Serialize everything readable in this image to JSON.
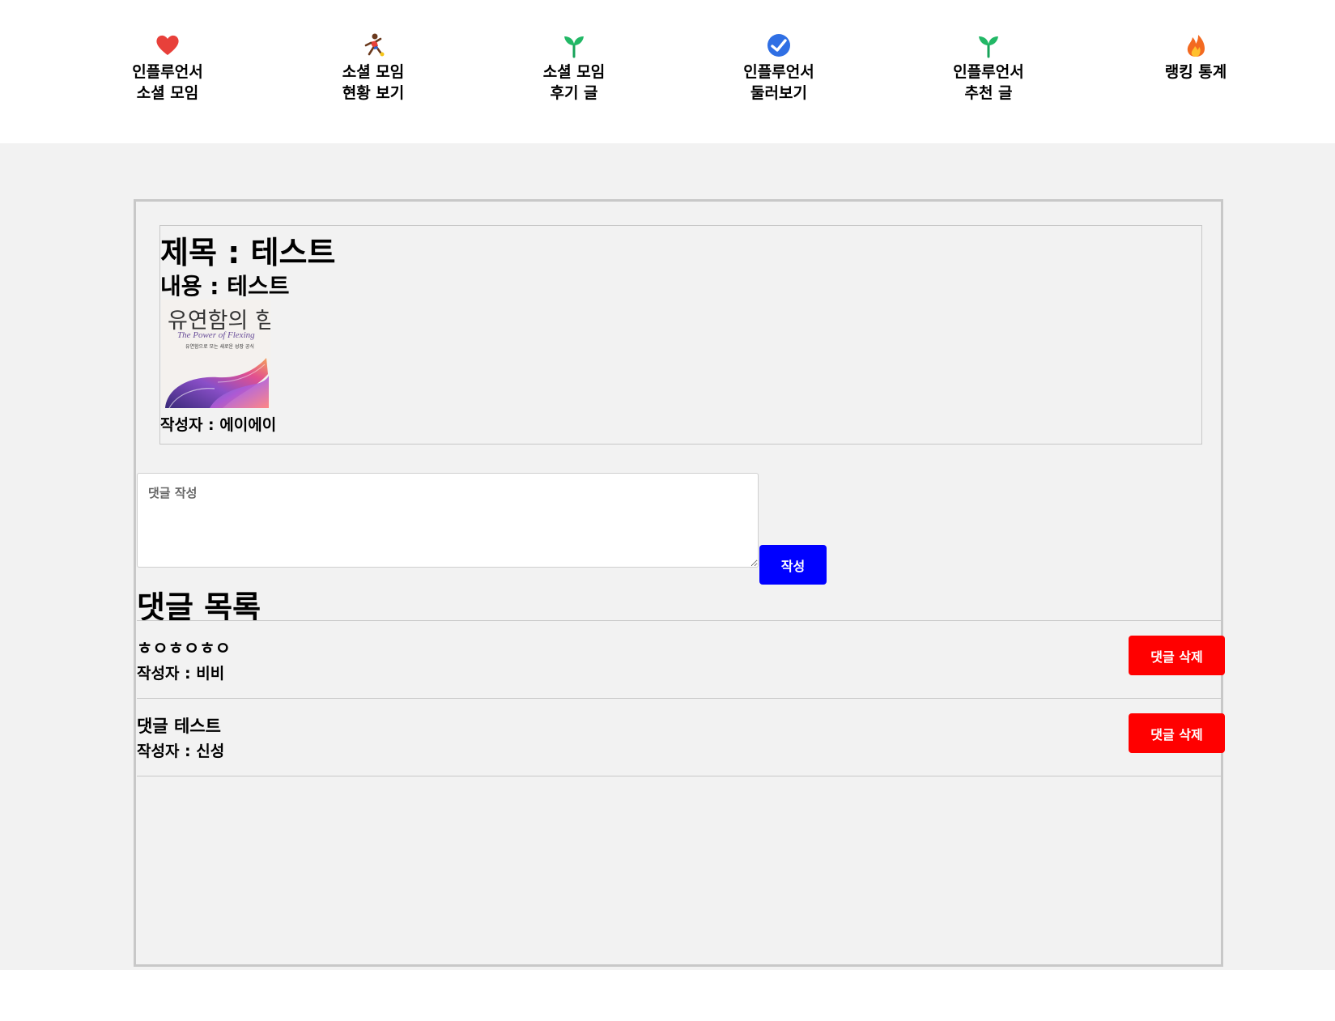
{
  "nav": {
    "items": [
      {
        "label": "인플루언서\n소셜 모임",
        "icon": "heart-icon"
      },
      {
        "label": "소셜 모임\n현황 보기",
        "icon": "runner-icon"
      },
      {
        "label": "소셜 모임\n후기 글",
        "icon": "sprout-icon"
      },
      {
        "label": "인플루언서\n둘러보기",
        "icon": "check-circle-icon"
      },
      {
        "label": "인플루언서\n추천 글",
        "icon": "sprout-icon"
      },
      {
        "label": "랭킹 통계",
        "icon": "fire-icon"
      }
    ]
  },
  "post": {
    "title": "제목 : 테스트",
    "content": "내용 : 테스트",
    "image": {
      "title": "유연함의 힘",
      "subtitle": "The Power of Flexing",
      "tagline": "유연함으로 모는 새로운 성장 공식"
    },
    "author": "작성자 : 에이에이"
  },
  "comment_form": {
    "placeholder": "댓글 작성",
    "value": "",
    "submit_label": "작성"
  },
  "comments": {
    "title": "댓글 목록",
    "items": [
      {
        "text": "ㅎㅇㅎㅇㅎㅇ",
        "author": "작성자 : 비비",
        "delete_label": "댓글 삭제"
      },
      {
        "text": "댓글 테스트",
        "author": "작성자 : 신성",
        "delete_label": "댓글 삭제"
      }
    ]
  },
  "colors": {
    "submit_button": "#0000ff",
    "delete_button": "#ff0000",
    "page_background": "#f2f2f2",
    "border": "#c8c8c8"
  }
}
